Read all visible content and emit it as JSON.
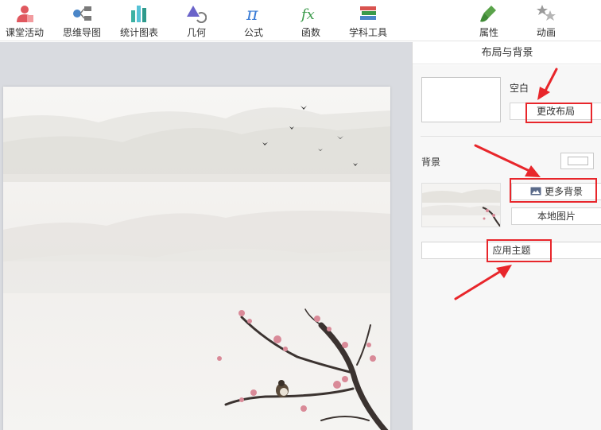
{
  "toolbar": {
    "items": [
      {
        "label": "课堂活动",
        "icon": "classroom-activity-icon",
        "color": "#e0585f"
      },
      {
        "label": "思维导图",
        "icon": "mind-map-icon",
        "color": "#4a86c8"
      },
      {
        "label": "统计图表",
        "icon": "bar-chart-icon",
        "color": "#3cb1a3"
      },
      {
        "label": "几何",
        "icon": "geometry-icon",
        "color": "#6a63c9"
      },
      {
        "label": "公式",
        "icon": "pi-formula-icon",
        "color": "#3a7cd6"
      },
      {
        "label": "函数",
        "icon": "fx-function-icon",
        "color": "#3a9a4a"
      },
      {
        "label": "学科工具",
        "icon": "subject-tools-icon",
        "color": "#d9534f"
      },
      {
        "label": "属性",
        "icon": "paint-brush-icon",
        "color": "#5aa34a"
      },
      {
        "label": "动画",
        "icon": "stars-animation-icon",
        "color": "#9a9a9a"
      }
    ]
  },
  "panel": {
    "title": "布局与背景",
    "layout_name": "空白",
    "change_layout_label": "更改布局",
    "background_label": "背景",
    "more_backgrounds_label": "更多背景",
    "local_image_label": "本地图片",
    "apply_theme_label": "应用主题"
  },
  "colors": {
    "canvas_bg": "#d9dbe0",
    "panel_bg": "#f7f7f7",
    "highlight": "#e8262b"
  }
}
